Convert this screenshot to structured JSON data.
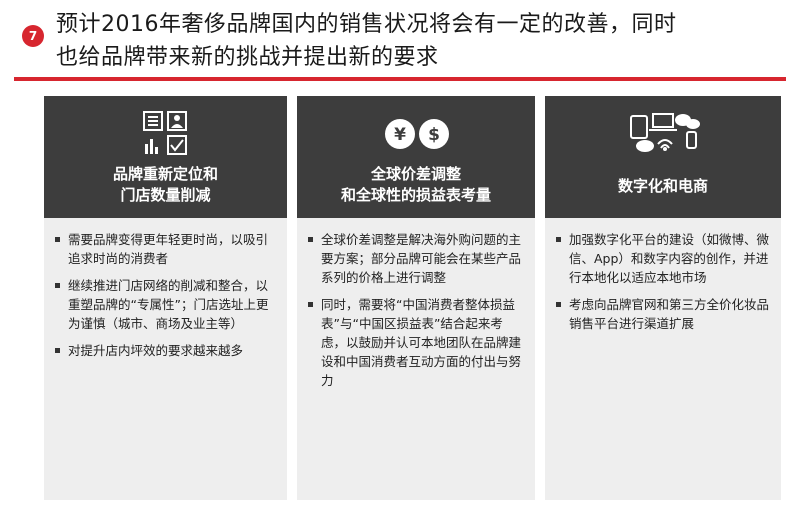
{
  "header": {
    "badge": "7",
    "title_line1": "预计2016年奢侈品牌国内的销售状况将会有一定的改善，同时",
    "title_line2": "也给品牌带来新的挑战并提出新的要求"
  },
  "panels": [
    {
      "icon": "document-grid-icons",
      "title_line1": "品牌重新定位和",
      "title_line2": "门店数量削减",
      "bullets": [
        "需要品牌变得更年轻更时尚，以吸引追求时尚的消费者",
        "继续推进门店网络的削减和整合，以重塑品牌的“专属性”；门店选址上更为谨慎（城市、商场及业主等）",
        "对提升店内坪效的要求越来越多"
      ]
    },
    {
      "icon": "currency-icons",
      "currency_symbols": [
        "¥",
        "$"
      ],
      "title_line1": "全球价差调整",
      "title_line2": "和全球性的损益表考量",
      "bullets": [
        "全球价差调整是解决海外购问题的主要方案；部分品牌可能会在某些产品系列的价格上进行调整",
        "同时，需要将“中国消费者整体损益表”与“中国区损益表”结合起来考虑，以鼓励并认可本地团队在品牌建设和中国消费者互动方面的付出与努力"
      ]
    },
    {
      "icon": "digital-device-icons",
      "title": "数字化和电商",
      "bullets": [
        "加强数字化平台的建设（如微博、微信、App）和数字内容的创作，并进行本地化以适应本地市场",
        "考虑向品牌官网和第三方全价化妆品销售平台进行渠道扩展"
      ]
    }
  ],
  "colors": {
    "accent": "#d7262f",
    "panel_header": "#3d3d3d",
    "panel_body": "#eeeeee"
  }
}
